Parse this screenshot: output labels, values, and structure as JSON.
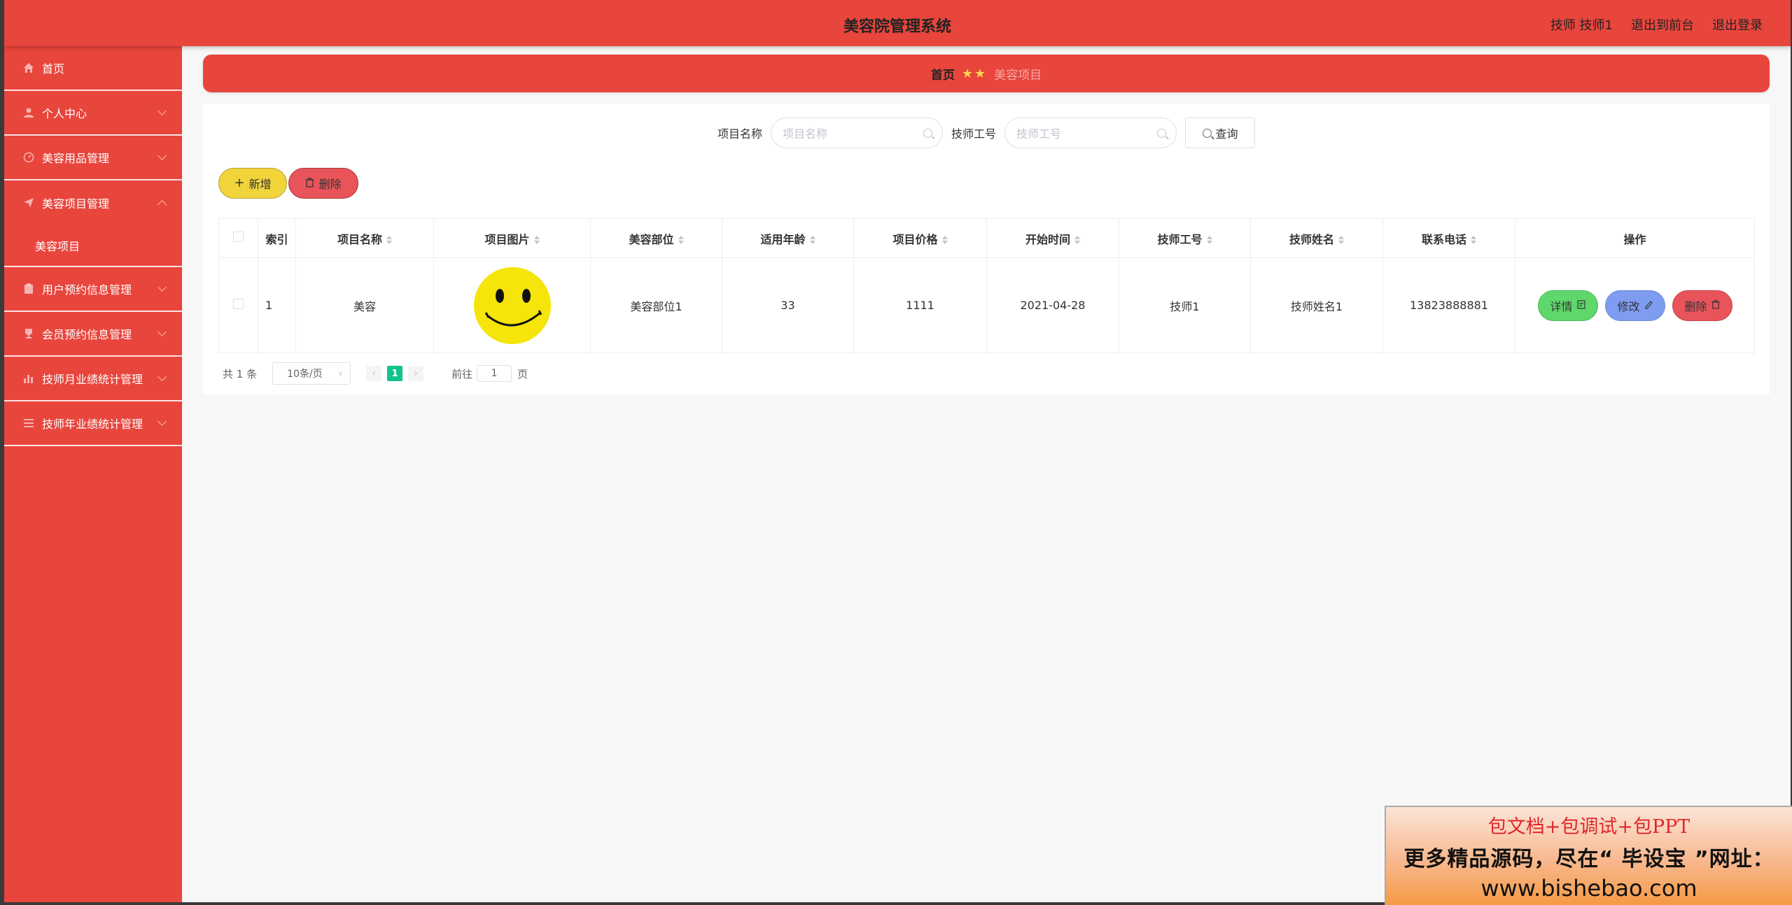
{
  "header": {
    "title": "美容院管理系统",
    "user": "技师 技师1",
    "goto_front": "退出到前台",
    "logout": "退出登录"
  },
  "sidebar": {
    "items": [
      {
        "label": "首页",
        "icon": "home-icon"
      },
      {
        "label": "个人中心",
        "icon": "user-icon"
      },
      {
        "label": "美容用品管理",
        "icon": "gauge-icon"
      },
      {
        "label": "美容项目管理",
        "icon": "send-icon",
        "expanded": true,
        "children": [
          {
            "label": "美容项目"
          }
        ]
      },
      {
        "label": "用户预约信息管理",
        "icon": "clipboard-icon"
      },
      {
        "label": "会员预约信息管理",
        "icon": "trophy-icon"
      },
      {
        "label": "技师月业绩统计管理",
        "icon": "bar-chart-icon"
      },
      {
        "label": "技师年业绩统计管理",
        "icon": "list-icon"
      }
    ]
  },
  "breadcrumb": {
    "home": "首页",
    "current": "美容项目"
  },
  "search": {
    "name_label": "项目名称",
    "name_placeholder": "项目名称",
    "tech_label": "技师工号",
    "tech_placeholder": "技师工号",
    "query_button": "查询"
  },
  "actions": {
    "add": "新增",
    "delete": "删除"
  },
  "table": {
    "headers": [
      "索引",
      "项目名称",
      "项目图片",
      "美容部位",
      "适用年龄",
      "项目价格",
      "开始时间",
      "技师工号",
      "技师姓名",
      "联系电话",
      "操作"
    ],
    "rows": [
      {
        "index": "1",
        "name": "美容",
        "part": "美容部位1",
        "age": "33",
        "price": "1111",
        "start": "2021-04-28",
        "tech_id": "技师1",
        "tech_name": "技师姓名1",
        "phone": "13823888881"
      }
    ],
    "op_detail": "详情",
    "op_edit": "修改",
    "op_delete": "删除"
  },
  "pagination": {
    "total": "共 1 条",
    "page_size": "10条/页",
    "current_page": "1",
    "goto_label": "前往",
    "goto_value": "1",
    "page_suffix": "页"
  },
  "promo": {
    "line1": "包文档+包调试+包PPT",
    "line2": "更多精品源码，尽在“ 毕设宝 ”网址：",
    "line3": "www.bishebao.com"
  },
  "colors": {
    "primary": "#e8453c",
    "add_button": "#f0d43a",
    "delete_button": "#e8545a",
    "detail_button": "#5fd86b",
    "edit_button": "#7e9cf0",
    "active_page": "#13c28e"
  }
}
